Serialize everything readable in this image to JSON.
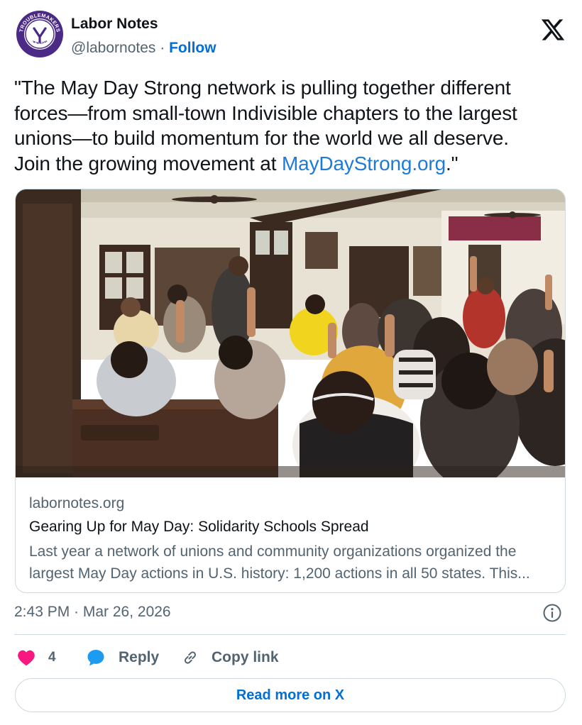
{
  "author": {
    "name": "Labor Notes",
    "handle": "@labornotes",
    "separator": "·",
    "follow_label": "Follow",
    "avatar_icon": "troublemakers-union-logo",
    "avatar_text_top": "TROUBLEMAKERS",
    "avatar_text_bottom": "UNION",
    "brand_color": "#4b2a86"
  },
  "platform_icon": "x-logo-icon",
  "tweet": {
    "text_line1": "\"The May Day Strong network is pulling together different",
    "text_line2": "forces—from small-town Indivisible chapters to the largest",
    "text_line3": "unions—to build momentum for the world we all deserve.",
    "text_line4_prefix": "Join the growing movement at ",
    "link_text": "MayDayStrong.org",
    "text_line4_suffix": ".\""
  },
  "link_card": {
    "image_description_icon": "meeting-photo",
    "domain": "labornotes.org",
    "title": "Gearing Up for May Day: Solidarity Schools Spread",
    "description_line1": "Last year a network of unions and community organizations organized the",
    "description_line2": "largest May Day actions in U.S. history: 1,200 actions in all 50 states. This..."
  },
  "timestamp": "2:43 PM · Mar 26, 2026",
  "actions": {
    "like_count": "4",
    "reply_label": "Reply",
    "copy_link_label": "Copy link"
  },
  "read_more_label": "Read more on X",
  "colors": {
    "like": "#f91880",
    "reply": "#1d9bf0",
    "link": "#006fd6",
    "muted": "#536471",
    "border": "#cfd9de"
  }
}
